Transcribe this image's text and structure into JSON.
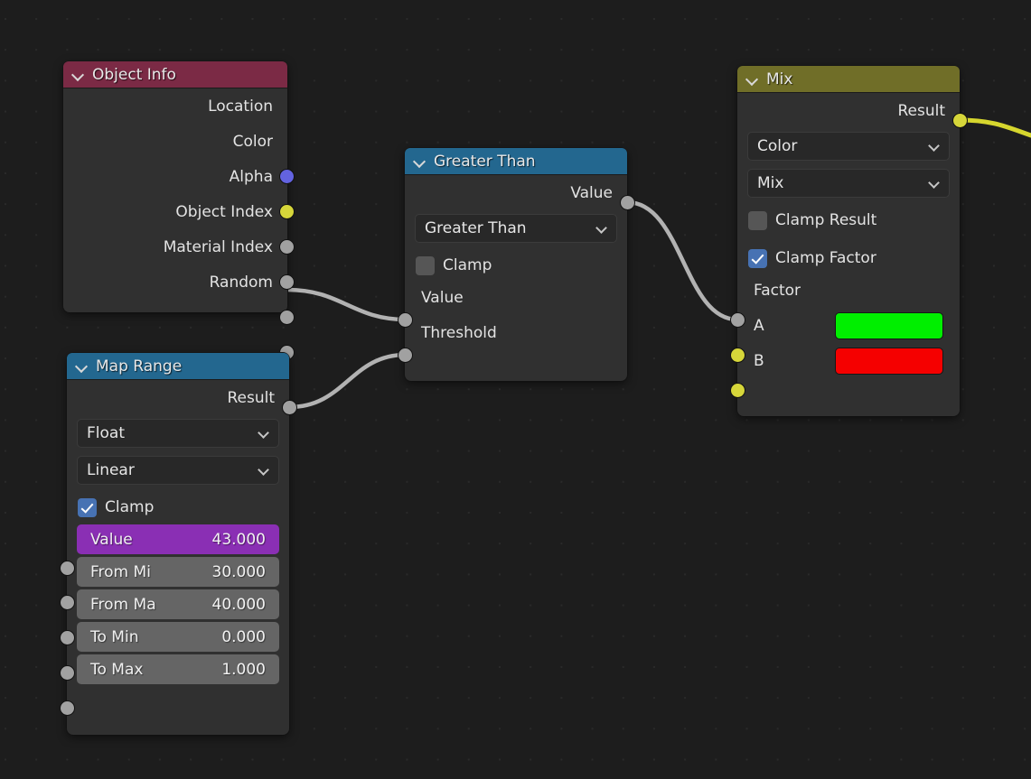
{
  "editor": {
    "name": "blender-shader-node-editor",
    "background_color": "#1d1d1d",
    "grid_dot_color": "#2a2a2a"
  },
  "socket_colors": {
    "vector": "#6363e0",
    "color": "#d6d63a",
    "value": "#a1a1a1"
  },
  "wire_colors": {
    "gray": "#b2b2b2",
    "yellow": "#d6d62e"
  },
  "nodes": {
    "object_info": {
      "title": "Object Info",
      "header_color": "#7b2a45",
      "collapse_icon": "chevron-down-icon",
      "outputs": [
        {
          "label": "Location",
          "socket": "vector"
        },
        {
          "label": "Color",
          "socket": "color"
        },
        {
          "label": "Alpha",
          "socket": "value"
        },
        {
          "label": "Object Index",
          "socket": "value"
        },
        {
          "label": "Material Index",
          "socket": "value"
        },
        {
          "label": "Random",
          "socket": "value"
        }
      ]
    },
    "map_range": {
      "title": "Map Range",
      "header_color": "#23678f",
      "collapse_icon": "chevron-down-icon",
      "outputs": [
        {
          "label": "Result",
          "socket": "value"
        }
      ],
      "data_type_dropdown": "Float",
      "interpolation_dropdown": "Linear",
      "clamp": {
        "label": "Clamp",
        "checked": true
      },
      "fields": [
        {
          "label": "Value",
          "value": "43.000",
          "accent": true
        },
        {
          "label": "From Mi",
          "value": "30.000",
          "accent": false
        },
        {
          "label": "From Ma",
          "value": "40.000",
          "accent": false
        },
        {
          "label": "To Min",
          "value": "0.000",
          "accent": false
        },
        {
          "label": "To Max",
          "value": "1.000",
          "accent": false
        }
      ]
    },
    "greater_than": {
      "title": "Greater Than",
      "header_color": "#23678f",
      "collapse_icon": "chevron-down-icon",
      "outputs": [
        {
          "label": "Value",
          "socket": "value"
        }
      ],
      "operation_dropdown": "Greater Than",
      "clamp": {
        "label": "Clamp",
        "checked": false
      },
      "inputs": [
        {
          "label": "Value",
          "socket": "value"
        },
        {
          "label": "Threshold",
          "socket": "value"
        }
      ]
    },
    "mix": {
      "title": "Mix",
      "header_color": "#706e28",
      "collapse_icon": "chevron-down-icon",
      "outputs": [
        {
          "label": "Result",
          "socket": "color"
        }
      ],
      "data_type_dropdown": "Color",
      "blend_mode_dropdown": "Mix",
      "clamp_result": {
        "label": "Clamp Result",
        "checked": false
      },
      "clamp_factor": {
        "label": "Clamp Factor",
        "checked": true
      },
      "inputs": [
        {
          "label": "Factor",
          "socket": "value"
        }
      ],
      "color_inputs": [
        {
          "label": "A",
          "socket": "color",
          "swatch": "#00ef00"
        },
        {
          "label": "B",
          "socket": "color",
          "swatch": "#f50000"
        }
      ]
    }
  }
}
